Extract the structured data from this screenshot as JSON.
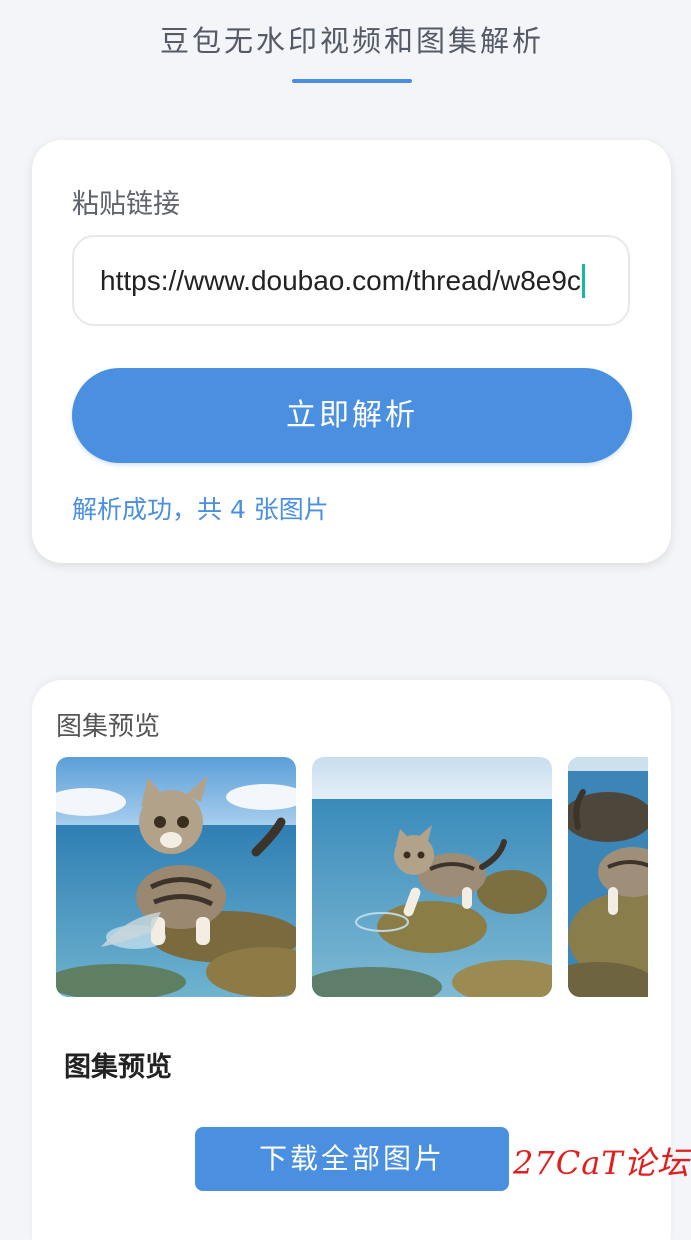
{
  "header": {
    "title": "豆包无水印视频和图集解析"
  },
  "input_card": {
    "label": "粘贴链接",
    "link_value": "https://www.doubao.com/thread/w8e9c",
    "parse_button_label": "立即解析",
    "status_text": "解析成功，共 4 张图片"
  },
  "gallery": {
    "heading": "图集预览",
    "images_count": 4,
    "thumbnails": [
      {
        "label": "kitten-catching-fish"
      },
      {
        "label": "kitten-on-rock"
      },
      {
        "label": "kitten-partial"
      }
    ],
    "subheading": "图集预览",
    "download_button_label": "下载全部图片"
  },
  "watermark": {
    "text": "27CaT论坛"
  },
  "colors": {
    "accent": "#4a8fe0",
    "background": "#f4f5f9",
    "caret": "#14b8a6",
    "watermark": "#e11d1d"
  }
}
